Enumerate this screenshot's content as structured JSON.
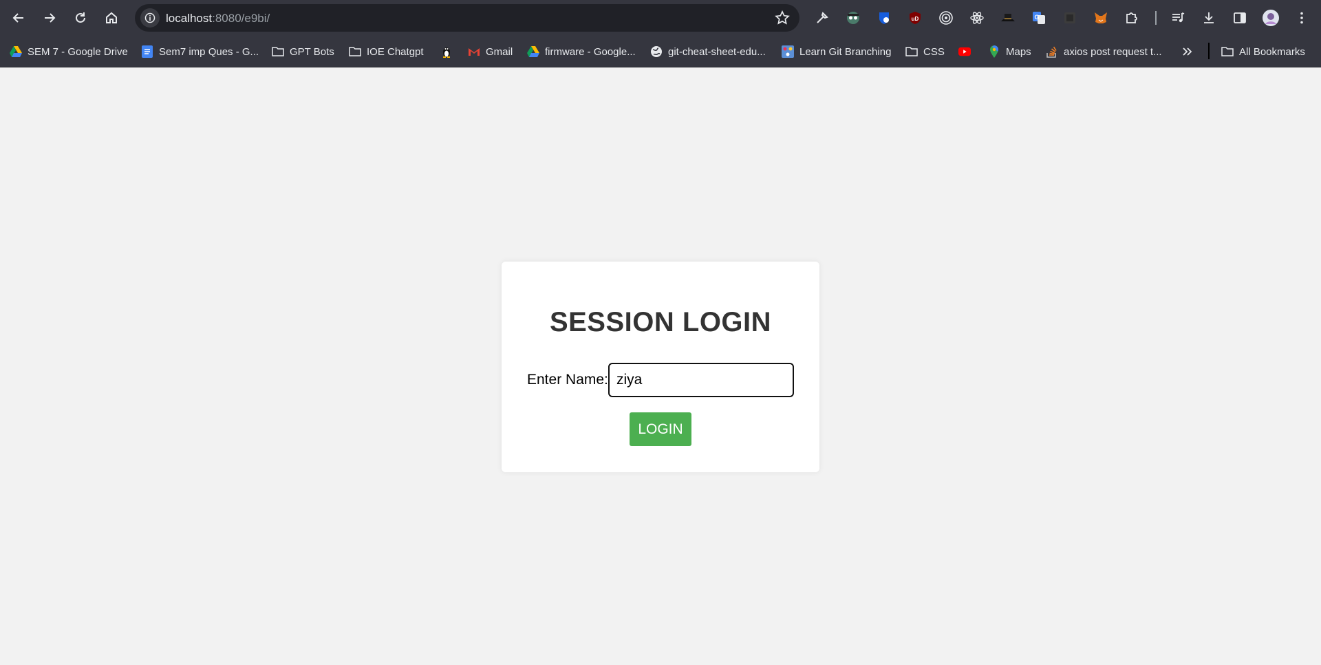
{
  "browser": {
    "url_host": "localhost",
    "url_path": ":8080/e9bi/",
    "bookmarks": [
      {
        "label": "SEM 7 - Google Drive",
        "icon": "google-drive-icon"
      },
      {
        "label": "Sem7 imp Ques - G...",
        "icon": "google-docs-icon"
      },
      {
        "label": "GPT Bots",
        "icon": "folder-icon"
      },
      {
        "label": "IOE Chatgpt",
        "icon": "folder-icon"
      },
      {
        "label": "",
        "icon": "linux-tux-icon"
      },
      {
        "label": "Gmail",
        "icon": "gmail-icon"
      },
      {
        "label": "firmware - Google...",
        "icon": "google-drive-icon"
      },
      {
        "label": "git-cheat-sheet-edu...",
        "icon": "globe-icon"
      },
      {
        "label": "Learn Git Branching",
        "icon": "learn-git-icon"
      },
      {
        "label": "CSS",
        "icon": "folder-icon"
      },
      {
        "label": "",
        "icon": "youtube-icon"
      },
      {
        "label": "Maps",
        "icon": "google-maps-icon"
      },
      {
        "label": "axios post request t...",
        "icon": "stackoverflow-icon"
      }
    ],
    "all_bookmarks_label": "All Bookmarks"
  },
  "login": {
    "title": "SESSION LOGIN",
    "name_label": "Enter Name:",
    "name_value": "ziya",
    "button_label": "LOGIN"
  },
  "colors": {
    "toolbar_bg": "#35363f",
    "page_bg": "#f2f2f2",
    "button_green": "#4caf50"
  }
}
